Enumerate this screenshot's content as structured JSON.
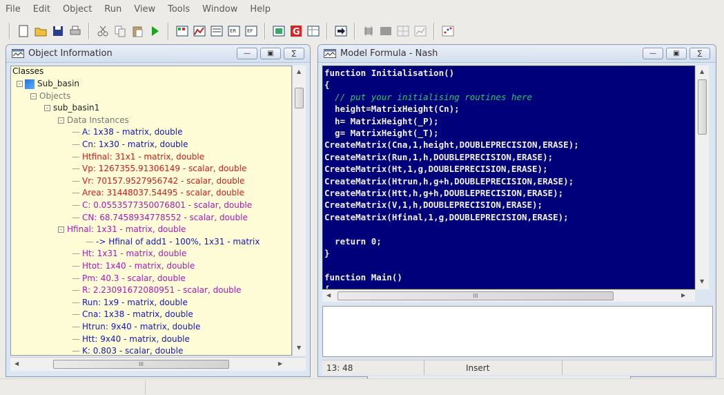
{
  "menu": [
    "File",
    "Edit",
    "Object",
    "Run",
    "View",
    "Tools",
    "Window",
    "Help"
  ],
  "toolbar": {
    "groups": [
      [
        "new-file-icon",
        "open-folder-icon",
        "save-icon",
        "print-icon"
      ],
      [
        "cut-icon",
        "copy-icon",
        "paste-icon",
        "run-icon"
      ],
      [
        "matrix-view-icon",
        "chart-icon",
        "edit-data-icon",
        "data-import-icon",
        "data-export-icon"
      ],
      [
        "formula-icon",
        "graph-g-icon",
        "table-icon"
      ],
      [
        "arrow-right-icon"
      ],
      [
        "chip-icon",
        "panel-icon",
        "grid-icon",
        "plot-icon"
      ],
      [
        "scatter-icon"
      ]
    ]
  },
  "left_panel": {
    "title": "Object Information",
    "header": "Classes",
    "tree": [
      {
        "text": "Sub_basin",
        "indent": 0,
        "color": "c-dark"
      },
      {
        "text": "Objects",
        "indent": 1,
        "color": "c-grey"
      },
      {
        "text": "sub_basin1",
        "indent": 2,
        "color": "c-dark"
      },
      {
        "text": "Data Instances",
        "indent": 3,
        "color": "c-grey"
      },
      {
        "text": "A: 1x38 - matrix, double",
        "indent": 4,
        "color": "c-blue"
      },
      {
        "text": "Cn: 1x30 - matrix, double",
        "indent": 4,
        "color": "c-blue"
      },
      {
        "text": "Htfinal: 31x1 - matrix, double",
        "indent": 4,
        "color": "c-red"
      },
      {
        "text": "Vp: 1267355.91306149 - scalar, double",
        "indent": 4,
        "color": "c-red"
      },
      {
        "text": "Vr: 70157.9527956742 - scalar, double",
        "indent": 4,
        "color": "c-red"
      },
      {
        "text": "Area: 31448037.54495 - scalar, double",
        "indent": 4,
        "color": "c-red"
      },
      {
        "text": "C: 0.0553577350076801 - scalar, double",
        "indent": 4,
        "color": "c-mag"
      },
      {
        "text": "CN: 68.7458934778552 - scalar, double",
        "indent": 4,
        "color": "c-mag"
      },
      {
        "text": "Hfinal: 1x31 - matrix, double",
        "indent": 3,
        "color": "c-mag"
      },
      {
        "text": "-> Hfinal of add1 - 100%, 1x31 - matrix",
        "indent": 5,
        "color": "c-blue"
      },
      {
        "text": "Ht: 1x31 - matrix, double",
        "indent": 4,
        "color": "c-mag"
      },
      {
        "text": "Htot: 1x40 - matrix, double",
        "indent": 4,
        "color": "c-mag"
      },
      {
        "text": "Pm: 40.3 - scalar, double",
        "indent": 4,
        "color": "c-mag"
      },
      {
        "text": "R: 2.23091672080951 - scalar, double",
        "indent": 4,
        "color": "c-mag"
      },
      {
        "text": "Run: 1x9 - matrix, double",
        "indent": 4,
        "color": "c-blue"
      },
      {
        "text": "Cna: 1x38 - matrix, double",
        "indent": 4,
        "color": "c-blue"
      },
      {
        "text": "Htrun: 9x40 - matrix, double",
        "indent": 4,
        "color": "c-blue"
      },
      {
        "text": "Htt: 9x40 - matrix, double",
        "indent": 4,
        "color": "c-blue"
      },
      {
        "text": "K: 0.803 - scalar, double",
        "indent": 4,
        "color": "c-blue"
      }
    ],
    "hscroll_label": "III"
  },
  "right_panel": {
    "title": "Model Formula - Nash",
    "code": [
      {
        "text": "function Initialisation()",
        "indent": 0,
        "type": "normal"
      },
      {
        "text": "{",
        "indent": 0,
        "type": "normal"
      },
      {
        "text": "  // put your initialising routines here",
        "indent": 0,
        "type": "comment"
      },
      {
        "text": "  height=MatrixHeight(Cn);",
        "indent": 0,
        "type": "normal"
      },
      {
        "text": "  h= MatrixHeight(_P);",
        "indent": 0,
        "type": "normal"
      },
      {
        "text": "  g= MatrixHeight(_T);",
        "indent": 0,
        "type": "normal"
      },
      {
        "text": "CreateMatrix(Cna,1,height,DOUBLEPRECISION,ERASE);",
        "indent": 0,
        "type": "normal"
      },
      {
        "text": "CreateMatrix(Run,1,h,DOUBLEPRECISION,ERASE);",
        "indent": 0,
        "type": "normal"
      },
      {
        "text": "CreateMatrix(Ht,1,g,DOUBLEPRECISION,ERASE);",
        "indent": 0,
        "type": "normal"
      },
      {
        "text": "CreateMatrix(Htrun,h,g+h,DOUBLEPRECISION,ERASE);",
        "indent": 0,
        "type": "normal"
      },
      {
        "text": "CreateMatrix(Htt,h,g+h,DOUBLEPRECISION,ERASE);",
        "indent": 0,
        "type": "normal"
      },
      {
        "text": "CreateMatrix(V,1,h,DOUBLEPRECISION,ERASE);",
        "indent": 0,
        "type": "normal"
      },
      {
        "text": "CreateMatrix(Hfinal,1,g,DOUBLEPRECISION,ERASE);",
        "indent": 0,
        "type": "normal"
      },
      {
        "text": "",
        "indent": 0,
        "type": "normal"
      },
      {
        "text": "  return 0;",
        "indent": 0,
        "type": "normal"
      },
      {
        "text": "}",
        "indent": 0,
        "type": "normal"
      },
      {
        "text": "",
        "indent": 0,
        "type": "normal"
      },
      {
        "text": "function Main()",
        "indent": 0,
        "type": "normal"
      },
      {
        "text": "{",
        "indent": 0,
        "type": "normal"
      }
    ],
    "hscroll_label": "III",
    "status": {
      "position": "13: 48",
      "mode": "Insert"
    }
  },
  "colors": {
    "code_bg": "#00007a",
    "tree_bg": "#fdfcd7",
    "comment": "#22c86a"
  }
}
